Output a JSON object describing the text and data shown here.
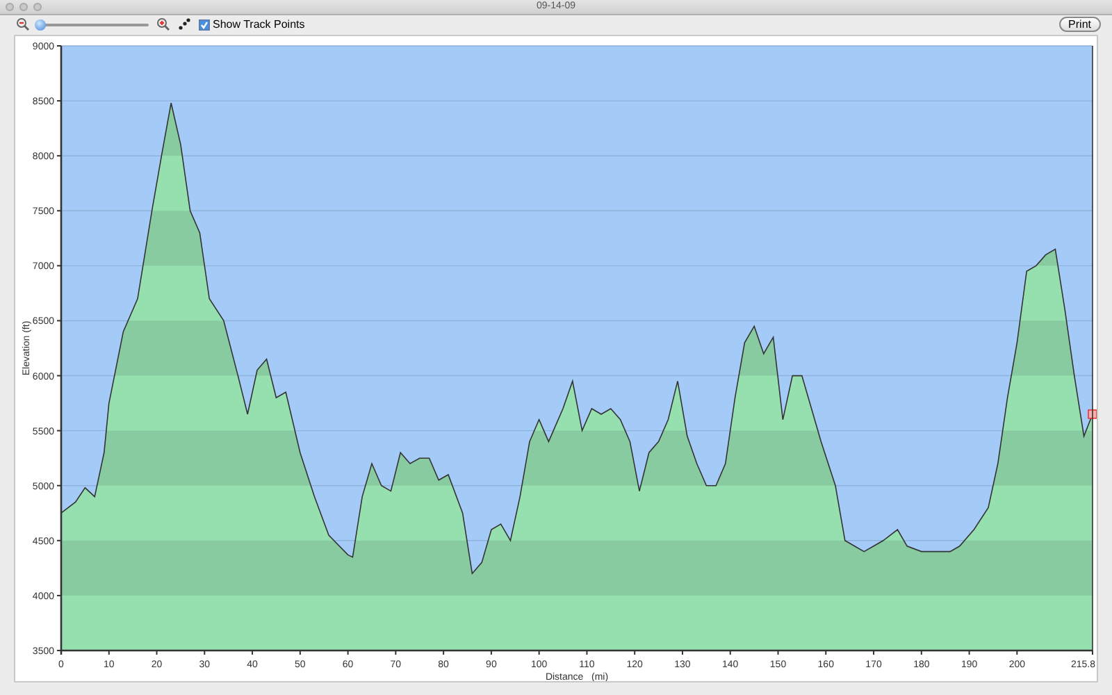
{
  "window": {
    "title": "09-14-09"
  },
  "toolbar": {
    "zoom_slider": {
      "level": 0.02
    },
    "show_track_points": {
      "label": "Show Track Points",
      "checked": true
    },
    "print_button": "Print"
  },
  "profile": {
    "chart_data": {
      "type": "area",
      "grid": true,
      "xlabel": "Distance   (mi)",
      "ylabel": "Elevation (ft)",
      "xlim": [
        0,
        215.8
      ],
      "ylim": [
        3500,
        9000
      ],
      "xticks": [
        0,
        10,
        20,
        30,
        40,
        50,
        60,
        70,
        80,
        90,
        100,
        110,
        120,
        130,
        140,
        150,
        160,
        170,
        180,
        190,
        200,
        {
          "value": 215.8,
          "label": "215.8"
        }
      ],
      "yticks": [
        3500,
        4000,
        4500,
        5000,
        5500,
        6000,
        6500,
        7000,
        7500,
        8000,
        8500,
        9000
      ],
      "x": [
        0,
        3,
        5,
        7,
        9,
        10,
        13,
        16,
        19,
        21,
        23,
        25,
        27,
        29,
        31,
        34,
        37,
        39,
        41,
        43,
        45,
        47,
        50,
        53,
        56,
        60,
        61,
        63,
        65,
        67,
        69,
        71,
        73,
        75,
        77,
        79,
        81,
        84,
        86,
        88,
        90,
        92,
        94,
        96,
        98,
        100,
        102,
        105,
        107,
        109,
        111,
        113,
        115,
        117,
        119,
        121,
        123,
        125,
        127,
        129,
        131,
        133,
        135,
        137,
        139,
        141,
        143,
        145,
        147,
        149,
        151,
        153,
        155,
        157,
        159,
        162,
        164,
        166,
        168,
        170,
        172,
        175,
        177,
        180,
        183,
        186,
        188,
        191,
        194,
        196,
        198,
        200,
        202,
        204,
        206,
        208,
        210,
        212,
        214,
        215.8
      ],
      "series": [
        {
          "color": "#96e0b0",
          "values": [
            4750,
            4850,
            4980,
            4900,
            5300,
            5750,
            6400,
            6700,
            7500,
            8000,
            8480,
            8100,
            7500,
            7300,
            6700,
            6500,
            6000,
            5650,
            6050,
            6150,
            5800,
            5850,
            5300,
            4900,
            4550,
            4370,
            4350,
            4900,
            5200,
            5000,
            4950,
            5300,
            5200,
            5250,
            5250,
            5050,
            5100,
            4750,
            4200,
            4300,
            4600,
            4650,
            4500,
            4900,
            5400,
            5600,
            5400,
            5700,
            5950,
            5500,
            5700,
            5650,
            5700,
            5600,
            5400,
            4950,
            5300,
            5400,
            5600,
            5950,
            5450,
            5200,
            5000,
            5000,
            5200,
            5800,
            6300,
            6450,
            6200,
            6350,
            5600,
            6000,
            6000,
            5700,
            5400,
            5000,
            4500,
            4450,
            4400,
            4450,
            4500,
            4600,
            4450,
            4400,
            4400,
            4400,
            4450,
            4600,
            4800,
            5200,
            5800,
            6300,
            6950,
            7000,
            7100,
            7150,
            6600,
            6000,
            5450,
            5650
          ]
        }
      ]
    },
    "cursor_marker": true
  }
}
